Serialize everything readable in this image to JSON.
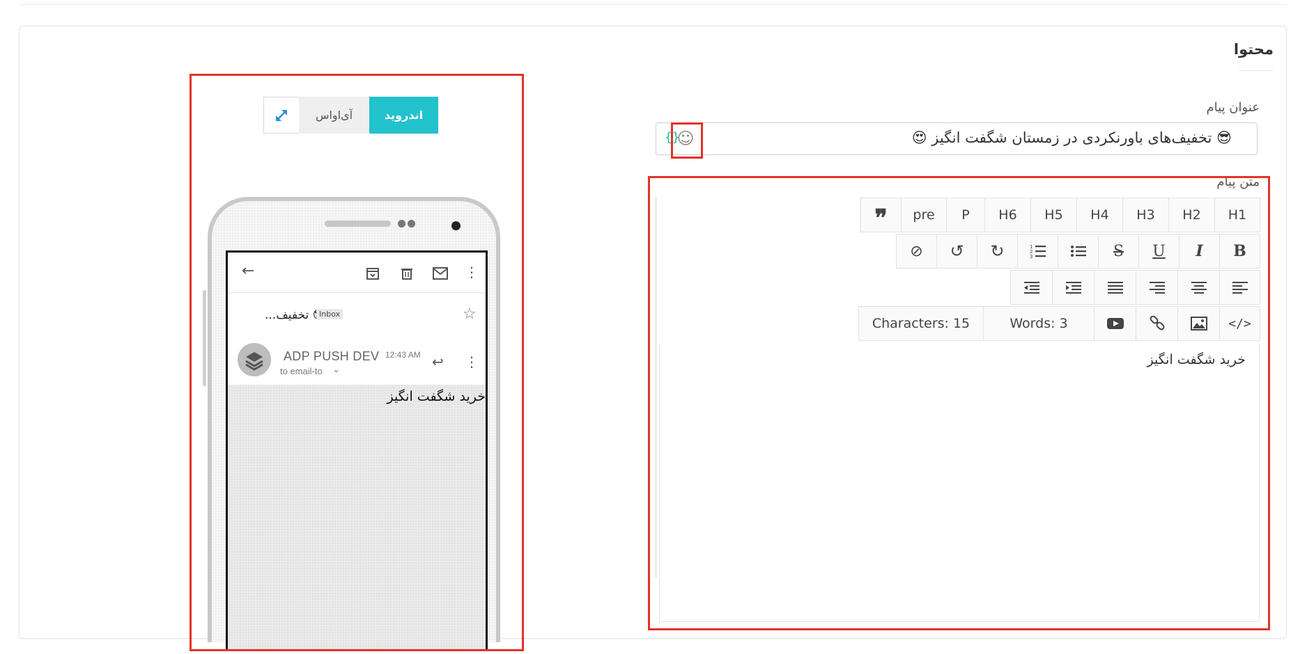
{
  "section": {
    "title": "محتوا"
  },
  "subject": {
    "label": "عنوان پیام",
    "value": "😎 تخفیف‌های باورنکردی در زمستان شگفت انگیز 😍",
    "variable_icon": "{}",
    "emoji_icon": "smile-icon"
  },
  "body": {
    "label": "متن پیام",
    "text": "خرید شگفت انگیز"
  },
  "toolbar": {
    "row1": [
      "H1",
      "H2",
      "H3",
      "H4",
      "H5",
      "H6",
      "P",
      "pre"
    ],
    "quote_icon": "quote-icon",
    "row2_icons": [
      "bold-icon",
      "italic-icon",
      "underline-icon",
      "strikethrough-icon",
      "unordered-list-icon",
      "ordered-list-icon",
      "redo-icon",
      "undo-icon",
      "clear-format-icon"
    ],
    "bold": "B",
    "italic": "I",
    "underline": "U",
    "strike": "S",
    "row3_icons": [
      "align-left-icon",
      "align-center-icon",
      "align-right-icon",
      "align-justify-icon",
      "indent-icon",
      "outdent-icon"
    ],
    "row4_icons": [
      "code-view-icon",
      "insert-image-icon",
      "insert-link-icon",
      "insert-video-icon"
    ],
    "words": "Words: 3",
    "characters": "Characters: 15"
  },
  "preview": {
    "tabs": {
      "android": "اندروید",
      "ios": "آی‌اواس"
    },
    "expand_icon": "expand-icon",
    "mail": {
      "subject_preview": "😎 تخفیف...",
      "inbox_badge": "Inbox",
      "sender": "ADP PUSH DEV",
      "to": "to email-to",
      "time": "12:43 AM",
      "body": "خرید شگفت انگیز"
    }
  },
  "colors": {
    "accent": "#22c2cc",
    "highlight": "#e53228",
    "variable_brace": "#1bb3a8"
  }
}
